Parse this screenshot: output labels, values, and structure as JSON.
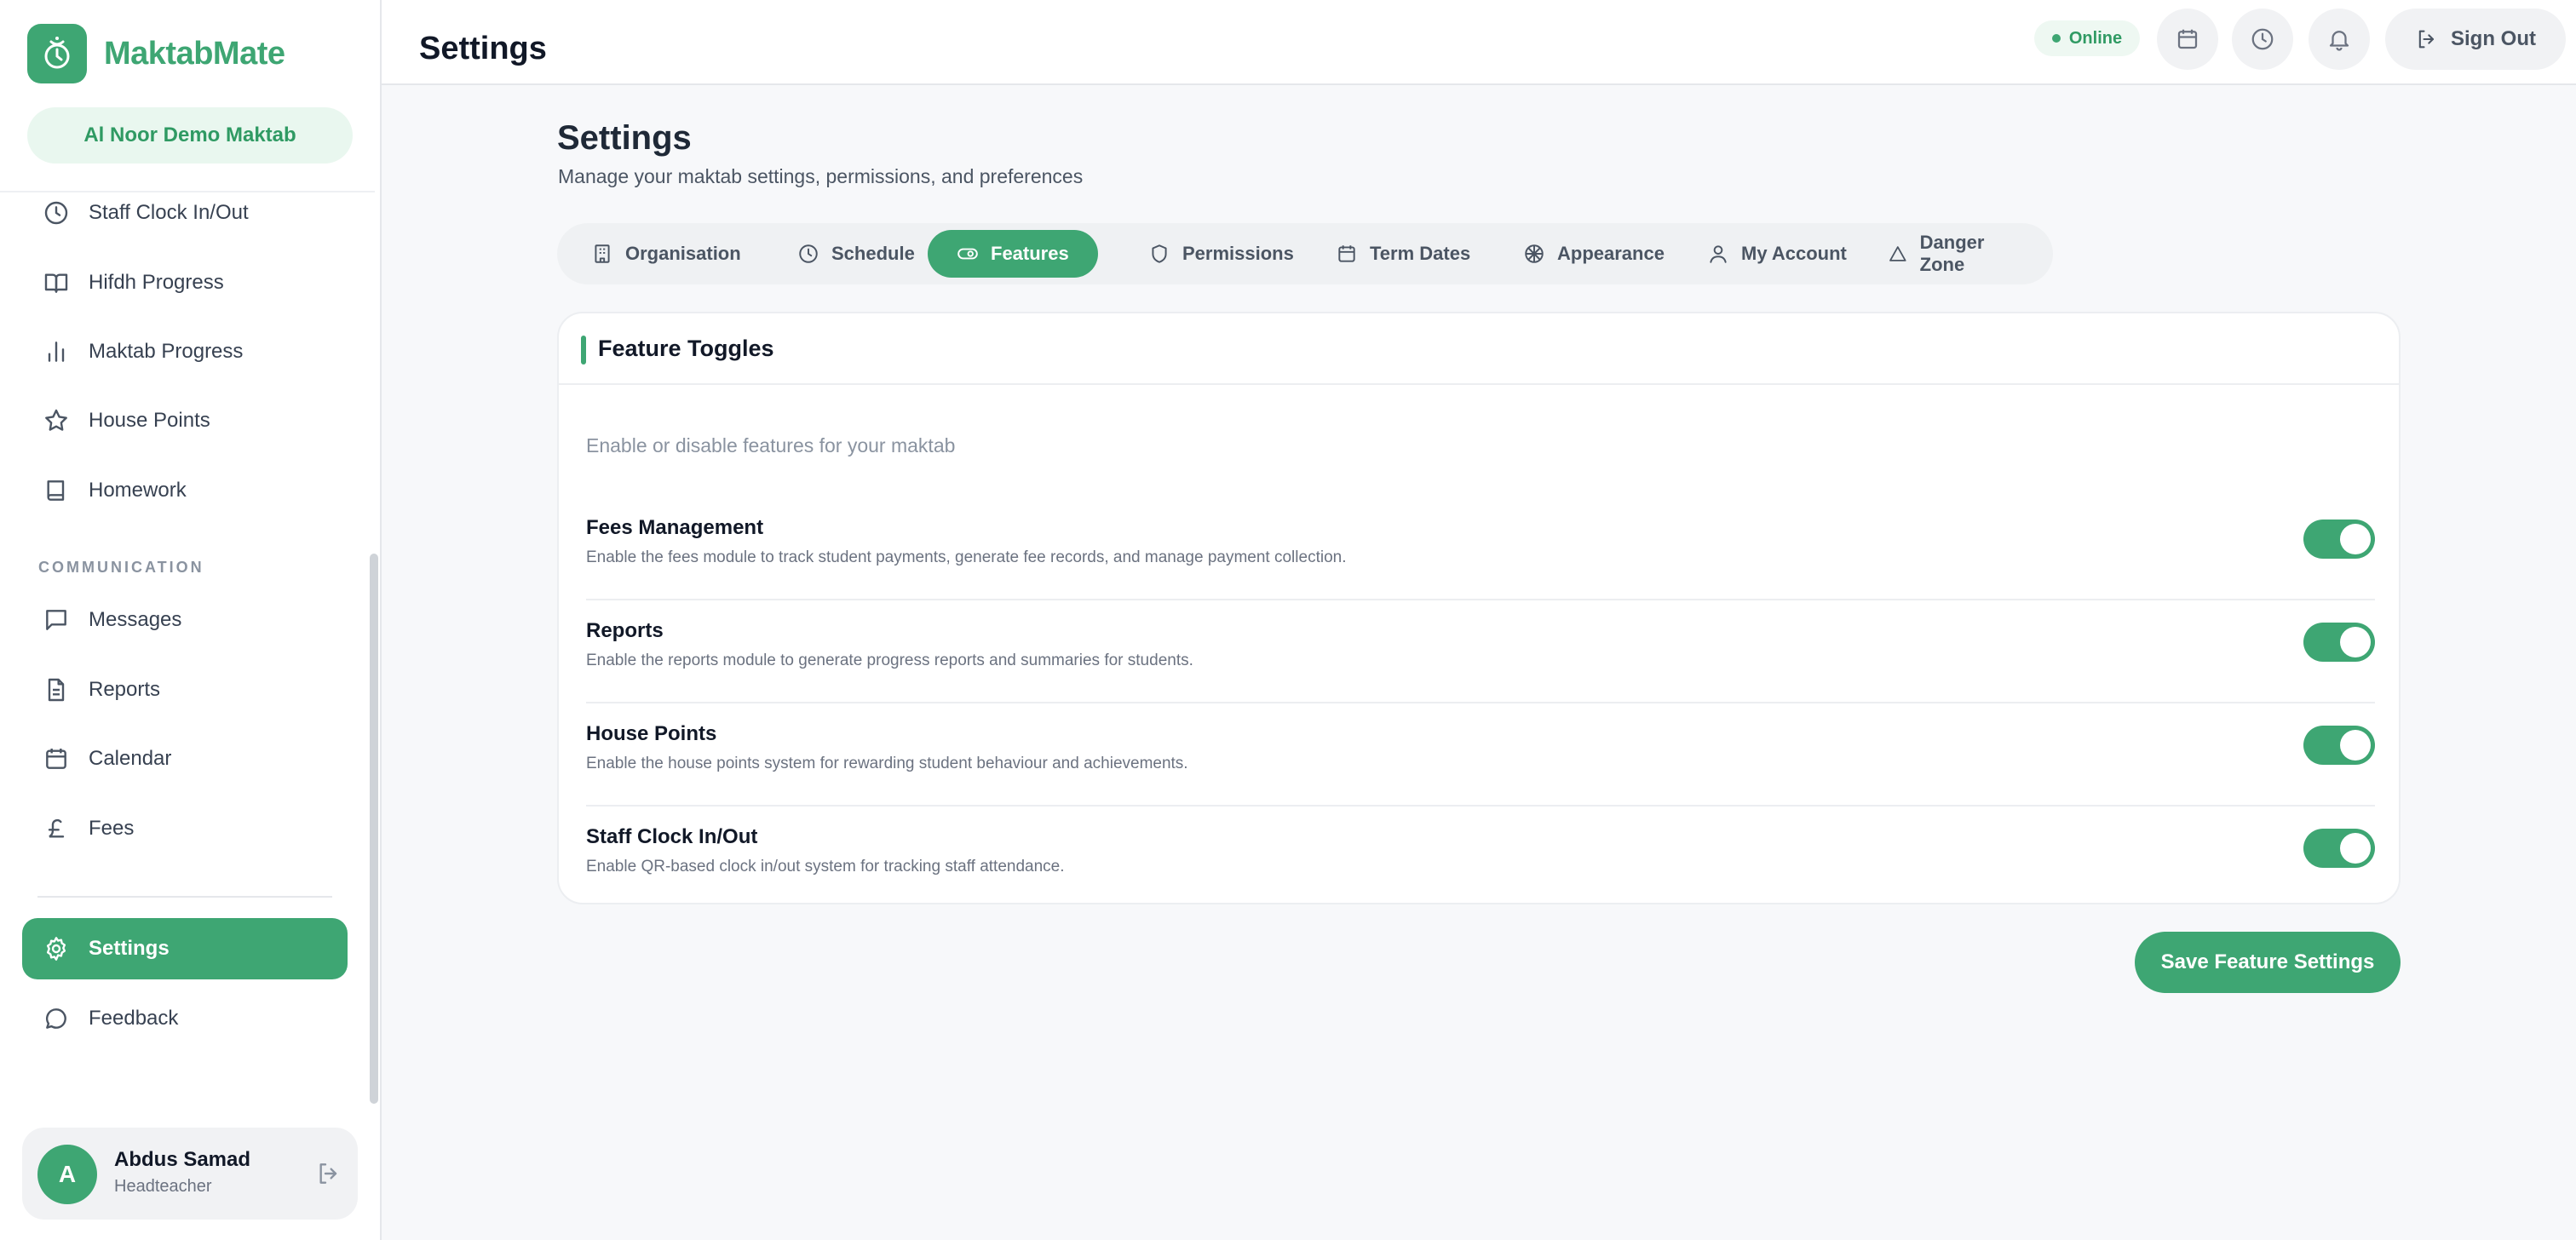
{
  "app": {
    "name": "MaktabMate",
    "organisation": "Al Noor Demo Maktab"
  },
  "sidebar": {
    "items_top": [
      {
        "label": "Staff Clock In/Out",
        "icon": "clock-icon"
      },
      {
        "label": "Hifdh Progress",
        "icon": "book-open-icon"
      },
      {
        "label": "Maktab Progress",
        "icon": "bar-chart-icon"
      },
      {
        "label": "House Points",
        "icon": "star-icon"
      },
      {
        "label": "Homework",
        "icon": "book-icon"
      }
    ],
    "section_communication": "COMMUNICATION",
    "items_comm": [
      {
        "label": "Messages",
        "icon": "message-icon"
      },
      {
        "label": "Reports",
        "icon": "file-text-icon"
      },
      {
        "label": "Calendar",
        "icon": "calendar-icon"
      },
      {
        "label": "Fees",
        "icon": "pound-icon"
      }
    ],
    "settings": {
      "label": "Settings",
      "icon": "gear-icon"
    },
    "feedback": {
      "label": "Feedback",
      "icon": "chat-bubble-icon"
    }
  },
  "user": {
    "initial": "A",
    "name": "Abdus Samad",
    "role": "Headteacher"
  },
  "topbar": {
    "title": "Settings",
    "status": "Online",
    "signout": "Sign Out"
  },
  "page": {
    "title": "Settings",
    "subtitle": "Manage your maktab settings, permissions, and preferences"
  },
  "tabs": [
    {
      "label": "Organisation",
      "icon": "building-icon"
    },
    {
      "label": "Schedule",
      "icon": "clock-icon"
    },
    {
      "label": "Features",
      "icon": "toggle-icon",
      "active": true
    },
    {
      "label": "Permissions",
      "icon": "shield-icon"
    },
    {
      "label": "Term Dates",
      "icon": "calendar-icon"
    },
    {
      "label": "Appearance",
      "icon": "palette-icon"
    },
    {
      "label": "My Account",
      "icon": "user-icon"
    },
    {
      "label": "Danger Zone",
      "icon": "warning-icon"
    }
  ],
  "features": {
    "title": "Feature Toggles",
    "description": "Enable or disable features for your maktab",
    "items": [
      {
        "name": "Fees Management",
        "text": "Enable the fees module to track student payments, generate fee records, and manage payment collection.",
        "enabled": true
      },
      {
        "name": "Reports",
        "text": "Enable the reports module to generate progress reports and summaries for students.",
        "enabled": true
      },
      {
        "name": "House Points",
        "text": "Enable the house points system for rewarding student behaviour and achievements.",
        "enabled": true
      },
      {
        "name": "Staff Clock In/Out",
        "text": "Enable QR-based clock in/out system for tracking staff attendance.",
        "enabled": true
      }
    ],
    "save_label": "Save Feature Settings"
  },
  "colors": {
    "accent": "#3ea673",
    "accent_light": "#e9f7ef"
  }
}
